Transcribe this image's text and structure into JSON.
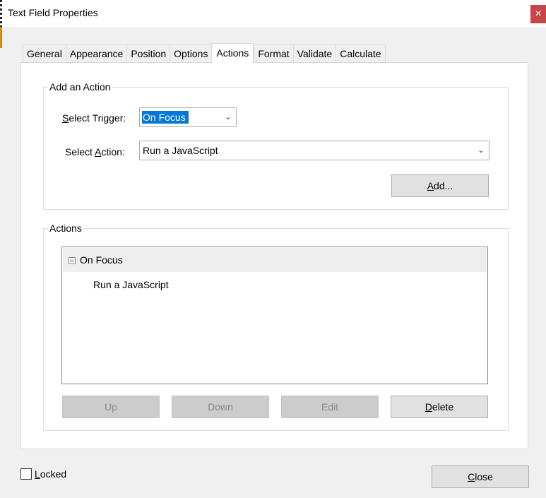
{
  "window": {
    "title": "Text Field Properties",
    "close_glyph": "×"
  },
  "tabs": [
    {
      "label": "General",
      "active": false
    },
    {
      "label": "Appearance",
      "active": false
    },
    {
      "label": "Position",
      "active": false
    },
    {
      "label": "Options",
      "active": false
    },
    {
      "label": "Actions",
      "active": true
    },
    {
      "label": "Format",
      "active": false
    },
    {
      "label": "Validate",
      "active": false
    },
    {
      "label": "Calculate",
      "active": false
    }
  ],
  "add_action": {
    "group_title": "Add an Action",
    "trigger_label_mnemonic": "S",
    "trigger_label_rest": "elect Trigger:",
    "trigger_value": "On Focus",
    "action_label_prefix": "Select ",
    "action_label_mnemonic": "A",
    "action_label_rest": "ction:",
    "action_value": "Run a JavaScript",
    "add_button_mnemonic": "A",
    "add_button_rest": "dd..."
  },
  "actions": {
    "group_title": "Actions",
    "tree": {
      "trigger": "On Focus",
      "children": [
        "Run a JavaScript"
      ]
    },
    "buttons": {
      "up": "Up",
      "down": "Down",
      "edit": "Edit",
      "delete_mnemonic": "D",
      "delete_rest": "elete"
    }
  },
  "footer": {
    "locked_mnemonic": "L",
    "locked_rest": "ocked",
    "locked_checked": false,
    "close_mnemonic": "C",
    "close_rest": "lose"
  },
  "icons": {
    "dropdown": "chevron-down-icon",
    "collapse": "minus-box-icon",
    "close": "close-icon"
  },
  "colors": {
    "selection": "#0078d7",
    "close_button": "#c7464a",
    "button_face": "#e1e1e1",
    "disabled_button": "#cccccc"
  }
}
